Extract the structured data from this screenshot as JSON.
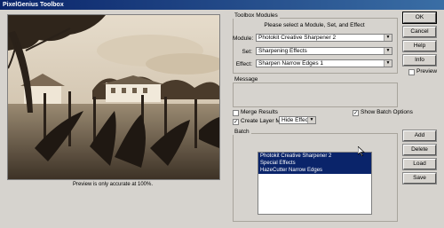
{
  "window": {
    "title": "PixelGenius Toolbox"
  },
  "preview": {
    "caption": "Preview is only accurate at 100%."
  },
  "modules": {
    "legend": "Toolbox Modules",
    "instruction": "Please select a Module, Set, and Effect",
    "module_label": "Module:",
    "module_value": "Photokit Creative Sharpener 2",
    "set_label": "Set:",
    "set_value": "Sharpening Effects",
    "effect_label": "Effect:",
    "effect_value": "Sharpen Narrow Edges 1"
  },
  "message": {
    "legend": "Message"
  },
  "options": {
    "merge_results": "Merge Results",
    "show_batch_options": "Show Batch Options",
    "create_layer_mask": "Create Layer Mask:",
    "layer_mask_value": "Hide Effect"
  },
  "batch": {
    "legend": "Batch",
    "items": [
      "Photokit Creative Sharpener 2",
      "Special Effects",
      "HazeCutter Narrow Edges"
    ]
  },
  "buttons": {
    "ok": "OK",
    "cancel": "Cancel",
    "help": "Help",
    "info": "Info",
    "preview": "Preview",
    "add": "Add",
    "delete": "Delete",
    "load": "Load",
    "save": "Save"
  }
}
